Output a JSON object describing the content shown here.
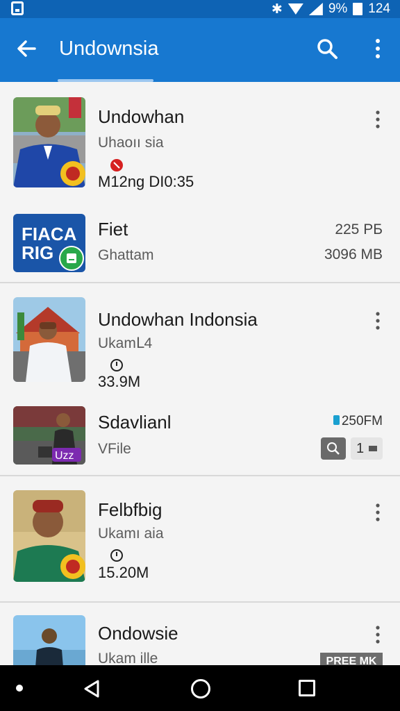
{
  "status_bar": {
    "battery_text": "9%",
    "time": "124"
  },
  "app_bar": {
    "title": "Undownsia"
  },
  "items": [
    {
      "name": "Undowhan",
      "subtitle": "Uhaoıı sia",
      "meta": "M12ng DI0:35"
    },
    {
      "name": "Fiet",
      "subtitle": "Ghattam",
      "right_top": "225 РБ",
      "right_bottom": "3096 MB",
      "logo_text": "FIACA RIG"
    },
    {
      "name": "Undowhan Indonsia",
      "subtitle": "Ukamᒪ4",
      "meta": "33.9M"
    },
    {
      "name": "Sdavlianl",
      "subtitle": "VFile",
      "right_top": "250FM",
      "pill_text": "1",
      "badge": "Uzz"
    },
    {
      "name": "Felbfbig",
      "subtitle": "Ukamı aia",
      "meta": "15.20M"
    },
    {
      "name": "Ondowsie",
      "subtitle": "Ukam ille",
      "badge": "PREE MK"
    }
  ],
  "colors": {
    "app_bar": "#1778d0",
    "status_bar": "#0e63b4"
  }
}
